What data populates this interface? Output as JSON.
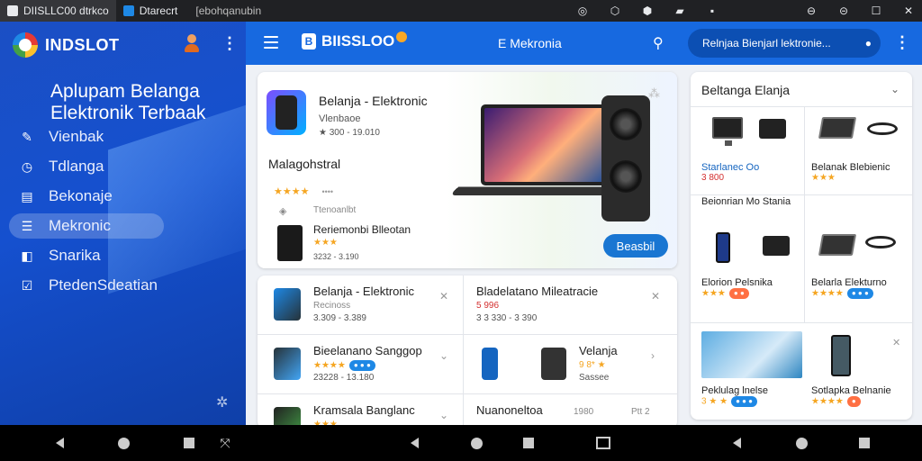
{
  "system_bar": {
    "tabs": [
      {
        "label": "DIISLLC00 dtrkco",
        "color": "#ffffff"
      },
      {
        "label": "Dtarecrt",
        "color": "#1e88e5"
      },
      {
        "label": "[ebohqanubin",
        "color": "#9e9e9e"
      }
    ],
    "icons": [
      "shield-icon",
      "shield-icon",
      "pin-icon",
      "flag-icon",
      "box-icon",
      "settings-icon",
      "minimize-icon",
      "maximize-icon",
      "close-icon"
    ]
  },
  "sidebar": {
    "brand": "INDSLOT",
    "title_line1": "Aplupam Belanga",
    "title_line2": "Elektronik Terbaak",
    "items": [
      {
        "label": "Vienbak",
        "icon": "edit-icon"
      },
      {
        "label": "Tdlanga",
        "icon": "clock-icon"
      },
      {
        "label": "Bekonaje",
        "icon": "document-icon"
      },
      {
        "label": "Mekronic",
        "icon": "list-icon"
      },
      {
        "label": "Snarika",
        "icon": "tag-icon"
      },
      {
        "label": "PtedenSdeatian",
        "icon": "checklist-icon"
      }
    ],
    "selected_index": 3
  },
  "appbar": {
    "logo_mark": "B",
    "logo_text": "BIISSLOO",
    "center_title": "E Mekronia",
    "search_placeholder": "Relnjaa Bienjarl lektronie..."
  },
  "hero": {
    "title": "Belanja - Elektronic",
    "subtitle": "Vlenbaoe",
    "price": "300 - 19.010",
    "section": "Malagohstral",
    "rating_stars": "★★★★",
    "rating_count": "••••",
    "small_note": "Ttenoanlbt",
    "product2_title": "Reriemonbi Blleotan",
    "product2_stars": "★★★",
    "product2_price": "3232 - 3.190",
    "cta": "Beasbil"
  },
  "right_panel": {
    "title": "Beltanga Elanja",
    "cells": [
      {
        "title": "Starlanec Oo",
        "price": "3 800",
        "blue": true
      },
      {
        "title": "Belanak Blebienic",
        "stars": "★★★",
        "price": ""
      },
      {
        "title": "Beionrian Mo Stania",
        "price": ""
      },
      {
        "title": "Elorion Pelsnika",
        "stars": "★★★",
        "badge": "● ●"
      },
      {
        "title": "Belarla Elekturno",
        "stars": "★★★★",
        "badge": "● ● ●"
      },
      {
        "title": "Peklulag lnelse",
        "stars": "3 ★ ★",
        "badge": "● ● ●"
      },
      {
        "title": "Sotlapka Belnanie",
        "stars": "★★★★",
        "badge": "●"
      }
    ]
  },
  "product_list": {
    "rows": [
      [
        {
          "title": "Belanja - Elektronic",
          "sub": "Recinoss",
          "price": "3.309 - 3.389"
        },
        {
          "title": "Bladelatano Mileatracie",
          "sub": "5 996",
          "price": "3 3 330 - 3 390"
        }
      ],
      [
        {
          "title": "Bieelanano Sanggop",
          "sub": "★★★★",
          "badge": "● ● ●",
          "price": "23228 - 13.180"
        },
        {
          "title": "Velanja",
          "sub": "9 8* ★",
          "price": "Sassee"
        }
      ],
      [
        {
          "title": "Kramsala Banglanc",
          "sub": "★★★",
          "price": ""
        },
        {
          "title": "Nuanoneltoa",
          "sub": "1980",
          "price": "Ptt 2"
        }
      ]
    ]
  }
}
